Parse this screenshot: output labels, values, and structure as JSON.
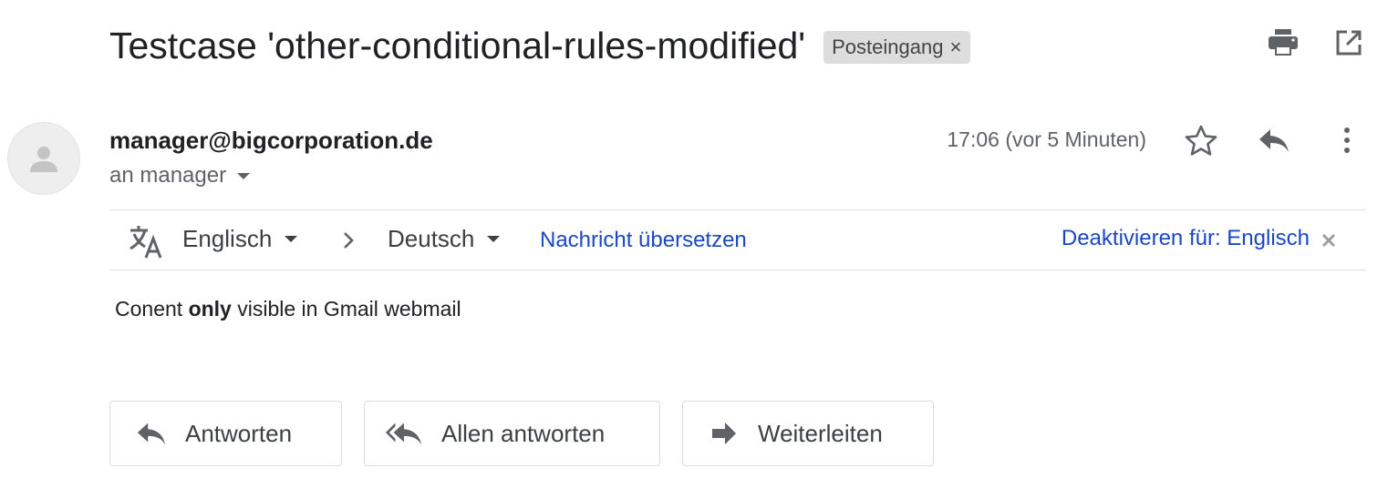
{
  "email": {
    "subject": "Testcase 'other-conditional-rules-modified'",
    "label": "Posteingang",
    "label_remove": "×",
    "sender": "manager@bigcorporation.de",
    "recipient": "an manager",
    "time": "17:06 (vor 5 Minuten)",
    "body_before": "Conent ",
    "body_bold": "only",
    "body_after": " visible in Gmail webmail"
  },
  "translate": {
    "from_lang": "Englisch",
    "to_lang": "Deutsch",
    "translate_link": "Nachricht übersetzen",
    "disable_link": "Deaktivieren für: Englisch"
  },
  "actions": {
    "reply": "Antworten",
    "reply_all": "Allen antworten",
    "forward": "Weiterleiten"
  },
  "icons": [
    "print-icon",
    "open-new-window-icon",
    "star-icon",
    "reply-icon",
    "more-vert-icon",
    "translate-icon",
    "chevron-right-icon",
    "close-icon",
    "reply-all-icon",
    "forward-icon",
    "person-icon"
  ],
  "colors": {
    "link": "#1a48c4",
    "text": "#202124",
    "muted": "#5f6368",
    "icon": "#5f6368"
  }
}
